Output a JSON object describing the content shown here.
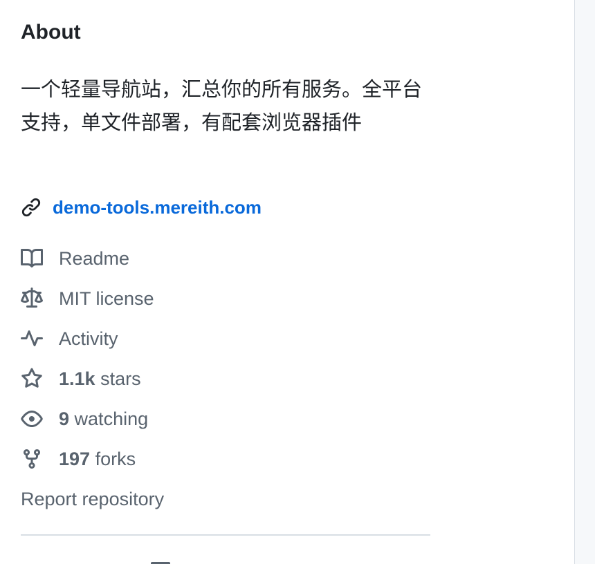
{
  "about": {
    "title": "About",
    "description": "一个轻量导航站，汇总你的所有服务。全平台支持，单文件部署，有配套浏览器插件",
    "homepage": "demo-tools.mereith.com",
    "readme_label": "Readme",
    "license_label": "MIT license",
    "activity_label": "Activity",
    "stars": {
      "count": "1.1k",
      "label": "stars"
    },
    "watching": {
      "count": "9",
      "label": "watching"
    },
    "forks": {
      "count": "197",
      "label": "forks"
    },
    "report_label": "Report repository"
  },
  "icons": {
    "homepage": "link-icon",
    "readme": "book-icon",
    "license": "law-scale-icon",
    "activity": "pulse-icon",
    "stars": "star-icon",
    "watching": "eye-icon",
    "forks": "fork-icon"
  },
  "colors": {
    "text": "#1f2328",
    "muted": "#59636e",
    "link": "#0969da",
    "border": "#d8dee4"
  }
}
